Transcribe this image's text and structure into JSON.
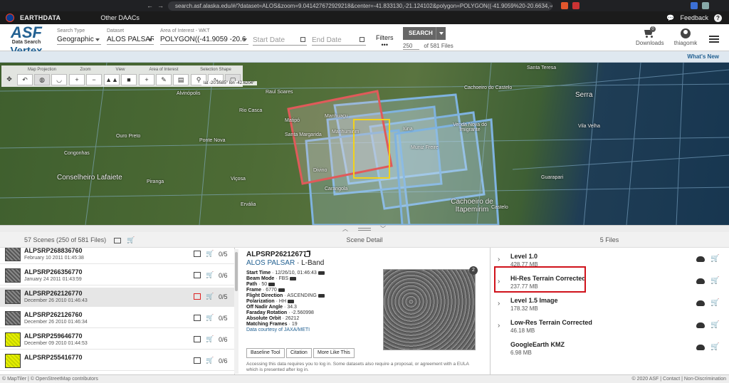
{
  "browser": {
    "url": "search.asf.alaska.edu/#/?dataset=ALOS&zoom=9.041427672929218&center=-41.833130,-21.124102&polygon=POLYGON((-41.9059%20-20.6634,-41.6599%..."
  },
  "earthdata": {
    "brand": "EARTHDATA",
    "other_daacs": "Other DAACs",
    "feedback": "Feedback",
    "help": "?"
  },
  "header": {
    "logo": {
      "asf": "ASF",
      "sub": "Data Search",
      "vertex": "Vertex"
    },
    "search_type": {
      "label": "Search Type",
      "value": "Geographic"
    },
    "dataset": {
      "label": "Dataset",
      "value": "ALOS PALSAR"
    },
    "aoi": {
      "label": "Area of Interest - WKT",
      "value": "POLYGON((-41.9059 -20.6"
    },
    "start_date": {
      "placeholder": "Start Date"
    },
    "end_date": {
      "placeholder": "End Date"
    },
    "filters": {
      "label": "Filters",
      "dots": "•••"
    },
    "search_button": "SEARCH",
    "max_results": "250",
    "of_files": "of 581 Files",
    "downloads": {
      "label": "Downloads",
      "count": "0"
    },
    "user": "thiagomk",
    "whats_new": "What's New"
  },
  "map_toolbar": {
    "groups": [
      {
        "label": "Map Projection",
        "buttons": [
          "↶",
          "◍",
          "◡"
        ]
      },
      {
        "label": "Zoom",
        "buttons": [
          "+",
          "−"
        ]
      },
      {
        "label": "View",
        "buttons": [
          "▲▲",
          "■"
        ]
      },
      {
        "label": "Area of Interest",
        "buttons": [
          "+",
          "✎",
          "▤"
        ]
      },
      {
        "label": "Selection Shape",
        "buttons": [
          "⚲",
          "∿",
          "▢"
        ]
      }
    ],
    "latlon": "lat -20.9585°  lon -42.6204°"
  },
  "map_labels": [
    "Alvinópolis",
    "Rio Casca",
    "Raul Soares",
    "Manhuaçu",
    "Manhumirim",
    "Matipó",
    "Santa Margarida",
    "Ouro Preto",
    "Ponte Nova",
    "Congonhas",
    "Conselheiro Lafaiete",
    "Piranga",
    "Viçosa",
    "Divino",
    "Ervália",
    "Carangola",
    "Iúna",
    "Muniz Freire",
    "Venda Nova do Imigrante",
    "Santa Teresa",
    "Castelo",
    "Serra",
    "Vila Velha",
    "Guarapari",
    "Cachoeiro de Itapemirim",
    "Cachoeiro do Castelo"
  ],
  "scenes_panel": {
    "header": "57 Scenes (250 of 581 Files)",
    "items": [
      {
        "name": "ALPSRP268836760",
        "date": "February 10 2011 01:45:38",
        "count": "0/5",
        "selected": false,
        "thumb": "gray"
      },
      {
        "name": "ALPSRP266356770",
        "date": "January 24 2011 01:43:59",
        "count": "0/6",
        "selected": false,
        "thumb": "gray"
      },
      {
        "name": "ALPSRP262126770",
        "date": "December 26 2010 01:46:43",
        "count": "0/5",
        "selected": true,
        "thumb": "gray"
      },
      {
        "name": "ALPSRP262126760",
        "date": "December 26 2010 01:46:34",
        "count": "0/5",
        "selected": false,
        "thumb": "gray"
      },
      {
        "name": "ALPSRP259646770",
        "date": "December 09 2010 01:44:53",
        "count": "0/6",
        "selected": false,
        "thumb": "yellow"
      },
      {
        "name": "ALPSRP255416770",
        "date": "",
        "count": "0/6",
        "selected": false,
        "thumb": "yellow"
      }
    ]
  },
  "detail_panel": {
    "header": "Scene Detail",
    "title": "ALPSRP262126770",
    "dataset": "ALOS PALSAR",
    "band": " · L-Band",
    "props": [
      {
        "k": "Start Time",
        "v": "12/26/10, 01:46:43",
        "tag": true
      },
      {
        "k": "Beam Mode",
        "v": "FBS",
        "tag": true
      },
      {
        "k": "Path",
        "v": "50",
        "tag": true
      },
      {
        "k": "Frame",
        "v": "6770",
        "tag": true
      },
      {
        "k": "Flight Direction",
        "v": "ASCENDING",
        "tag": true
      },
      {
        "k": "Polarization",
        "v": "HH",
        "tag": true
      },
      {
        "k": "Off Nadir Angle",
        "v": "34.3",
        "tag": false
      },
      {
        "k": "Faraday Rotation",
        "v": "-2.560998",
        "tag": false
      },
      {
        "k": "Absolute Orbit",
        "v": "26212",
        "tag": false
      },
      {
        "k": "Matching Frames",
        "v": "19",
        "tag": false
      }
    ],
    "courtesy": "Data courtesy of JAXA/METI",
    "browse_count": "2",
    "buttons": [
      "Baseline Tool",
      "Citation",
      "More Like This"
    ],
    "notice": "Accessing this data requires you to log in. Some datasets also require a proposal, or agreement with a EULA which is presented after log in."
  },
  "files_panel": {
    "header": "5 Files",
    "items": [
      {
        "name": "Level 1.0",
        "size": "428.77 MB",
        "expandable": true
      },
      {
        "name": "Hi-Res Terrain Corrected",
        "size": "237.77 MB",
        "expandable": true
      },
      {
        "name": "Level 1.5 Image",
        "size": "178.32 MB",
        "expandable": true
      },
      {
        "name": "Low-Res Terrain Corrected",
        "size": "46.18 MB",
        "expandable": true
      },
      {
        "name": "GoogleEarth KMZ",
        "size": "6.98 MB",
        "expandable": false
      }
    ]
  },
  "footer": {
    "left": "© MapTiler  |  © OpenStreetMap contributors",
    "right": "© 2020 ASF  |  Contact  |  Non-Discrimination"
  },
  "colors": {
    "accent": "#236192",
    "highlight_box": "#d0121b",
    "yellow_footprint": "#f2d21b",
    "red_footprint": "#e05a5a",
    "blue_footprint": "#7fb3e0"
  }
}
